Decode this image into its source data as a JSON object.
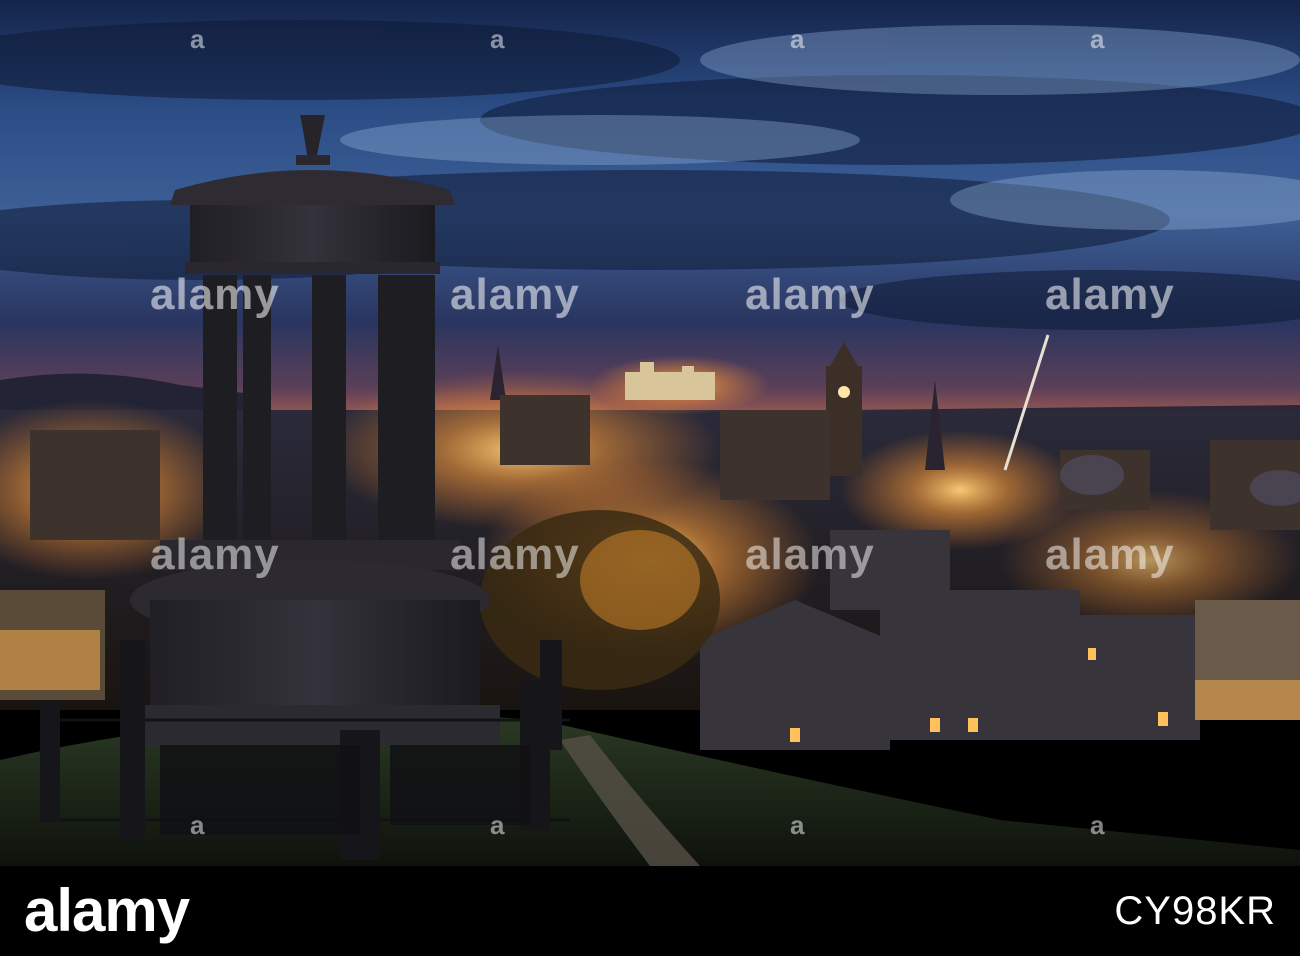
{
  "watermark": {
    "word": "alamy",
    "mark": "a"
  },
  "footer": {
    "brand": "alamy",
    "image_id": "CY98KR",
    "background_color": "#000000",
    "text_color": "#ffffff"
  },
  "scene": {
    "sky_colors": [
      "#0b1530",
      "#1f3a6e",
      "#4f79b1",
      "#7da3d0"
    ],
    "glow_color": "#ffb347",
    "horizon_color": "#c96a55"
  }
}
